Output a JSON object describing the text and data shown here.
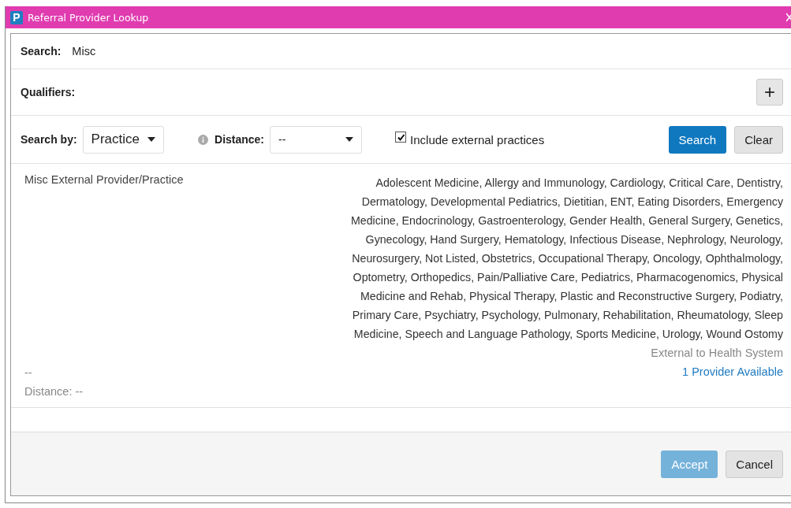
{
  "window": {
    "title": "Referral Provider Lookup",
    "logo": "P"
  },
  "search": {
    "label": "Search:",
    "value": "Misc"
  },
  "qualifiers": {
    "label": "Qualifiers:",
    "add_button": "+"
  },
  "filters": {
    "search_by_label": "Search by:",
    "search_by_value": "Practice",
    "distance_label": "Distance:",
    "distance_value": "--",
    "include_external": {
      "label": "Include external practices",
      "checked": true
    },
    "search_button": "Search",
    "clear_button": "Clear"
  },
  "results": [
    {
      "name": "Misc External Provider/Practice",
      "specialties": "Adolescent Medicine, Allergy and Immunology, Cardiology, Critical Care, Dentistry, Dermatology, Developmental Pediatrics, Dietitian, ENT, Eating Disorders, Emergency Medicine, Endocrinology, Gastroenterology, Gender Health, General Surgery, Genetics, Gynecology, Hand Surgery, Hematology, Infectious Disease, Nephrology, Neurology, Neurosurgery, Not Listed, Obstetrics, Occupational Therapy, Oncology, Ophthalmology, Optometry, Orthopedics, Pain/Palliative Care, Pediatrics, Pharmacogenomics, Physical Medicine and Rehab, Physical Therapy, Plastic and Reconstructive Surgery, Podiatry, Primary Care, Psychiatry, Psychology, Pulmonary, Rehabilitation, Rheumatology, Sleep Medicine, Speech and Language Pathology, Sports Medicine, Urology, Wound Ostomy",
      "address": "--",
      "distance": "Distance: --",
      "affiliation": "External to Health System",
      "providers_link": "1 Provider Available"
    }
  ],
  "footer": {
    "accept_button": {
      "label": "Accept",
      "disabled": true
    },
    "cancel_button": "Cancel"
  }
}
